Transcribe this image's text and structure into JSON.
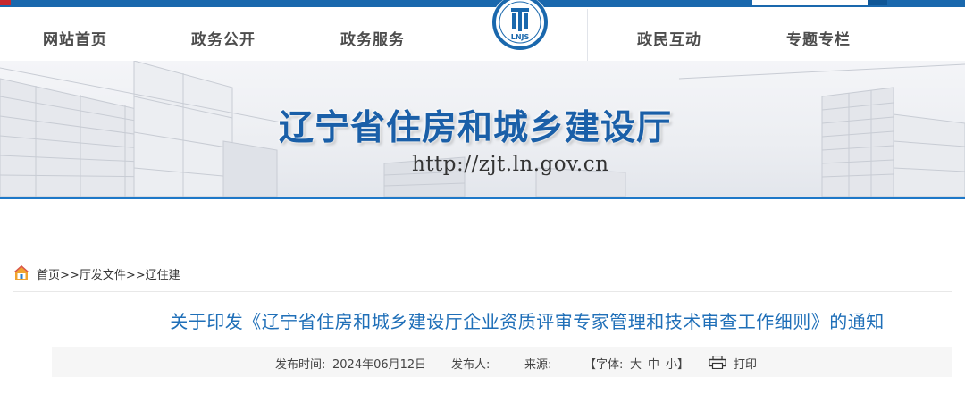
{
  "nav": {
    "items": [
      {
        "label": "网站首页"
      },
      {
        "label": "政务公开"
      },
      {
        "label": "政务服务"
      },
      {
        "label": "政民互动"
      },
      {
        "label": "专题专栏"
      }
    ],
    "logo_text": "LNJS"
  },
  "banner": {
    "title": "辽宁省住房和城乡建设厅",
    "url": "http://zjt.ln.gov.cn"
  },
  "breadcrumb": {
    "home": "首页",
    "sep1": ">>",
    "section": "厅发文件",
    "sep2": ">>",
    "current": "辽住建"
  },
  "article": {
    "title": "关于印发《辽宁省住房和城乡建设厅企业资质评审专家管理和技术审查工作细则》的通知",
    "publish_label": "发布时间:",
    "publish_date": "2024年06月12日",
    "publisher_label": "发布人:",
    "source_label": "来源:",
    "font_label": "【字体:",
    "font_large": "大",
    "font_medium": "中",
    "font_small": "小",
    "font_close": "】",
    "print_label": "打印"
  },
  "colors": {
    "accent": "#1a68ad",
    "title_blue": "#1f6fb8",
    "red_mark": "#c7282e"
  }
}
